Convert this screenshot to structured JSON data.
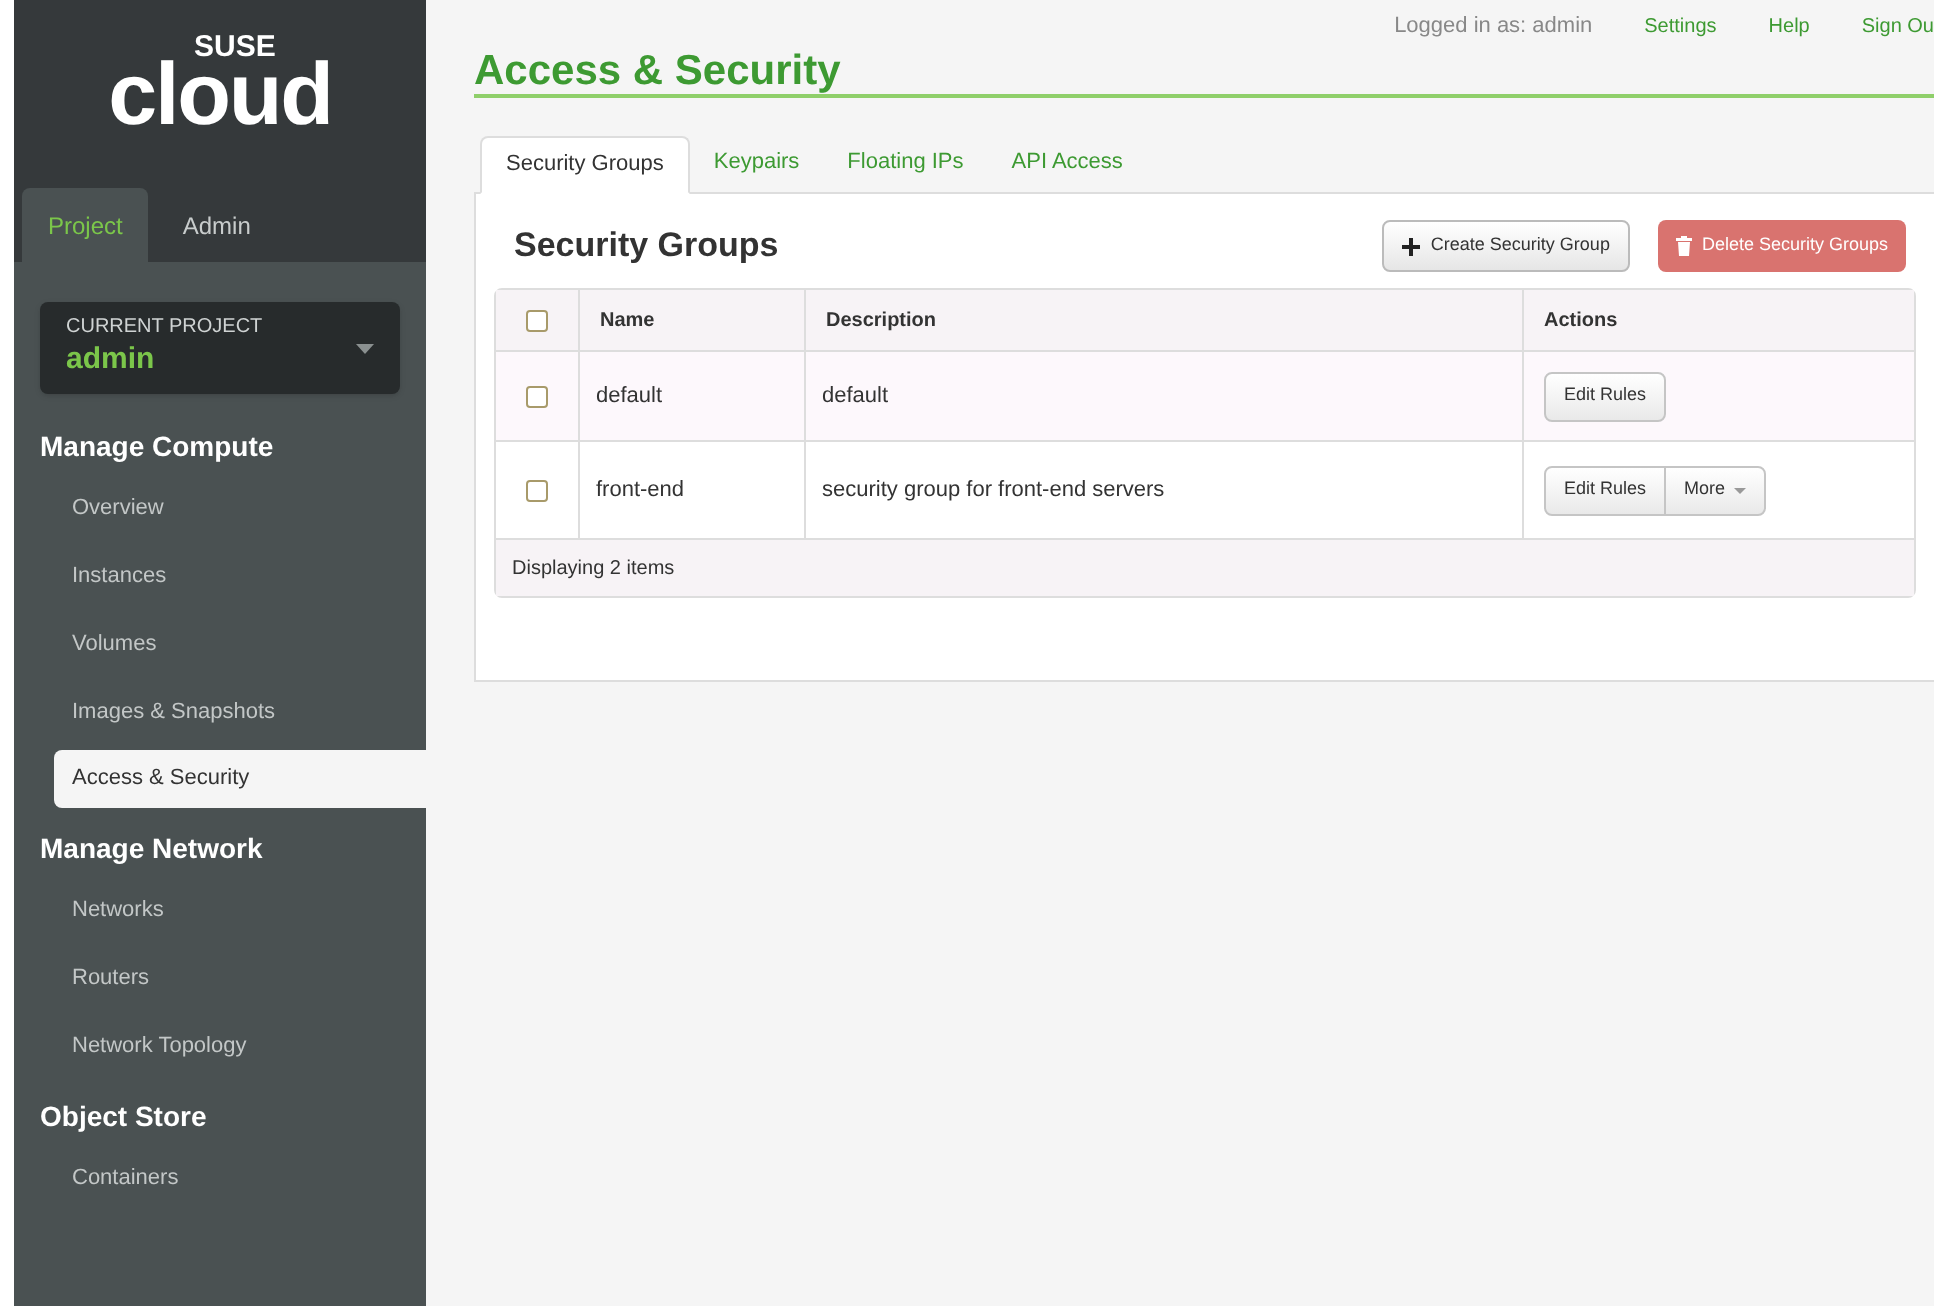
{
  "logo": {
    "brand": "SUSE",
    "product": "cloud"
  },
  "dashboard_tabs": [
    {
      "label": "Project",
      "selected": true
    },
    {
      "label": "Admin",
      "selected": false
    }
  ],
  "current_project": {
    "label": "CURRENT PROJECT",
    "value": "admin"
  },
  "sidebar": [
    {
      "heading": "Manage Compute",
      "items": [
        {
          "label": "Overview",
          "selected": false
        },
        {
          "label": "Instances",
          "selected": false
        },
        {
          "label": "Volumes",
          "selected": false
        },
        {
          "label": "Images & Snapshots",
          "selected": false
        },
        {
          "label": "Access & Security",
          "selected": true
        }
      ]
    },
    {
      "heading": "Manage Network",
      "items": [
        {
          "label": "Networks",
          "selected": false
        },
        {
          "label": "Routers",
          "selected": false
        },
        {
          "label": "Network Topology",
          "selected": false
        }
      ]
    },
    {
      "heading": "Object Store",
      "items": [
        {
          "label": "Containers",
          "selected": false
        }
      ]
    }
  ],
  "page_title": "Access & Security",
  "user_bar": {
    "logged_in": "Logged in as: admin",
    "links": [
      "Settings",
      "Help",
      "Sign Ou"
    ]
  },
  "tabs": [
    {
      "label": "Security Groups",
      "selected": true
    },
    {
      "label": "Keypairs",
      "selected": false
    },
    {
      "label": "Floating IPs",
      "selected": false
    },
    {
      "label": "API Access",
      "selected": false
    }
  ],
  "table_title": "Security Groups",
  "table_actions": [
    {
      "kind": "create",
      "label": "Create Security Group"
    },
    {
      "kind": "delete",
      "label": "Delete Security Groups"
    }
  ],
  "table": {
    "select_all_checked": false,
    "columns": [
      "Name",
      "Description",
      "Actions"
    ],
    "rows": [
      {
        "checked": false,
        "name": "default",
        "description": "default",
        "actions": [
          {
            "kind": "button",
            "label": "Edit Rules"
          }
        ]
      },
      {
        "checked": false,
        "name": "front-end",
        "description": "security group for front-end servers",
        "actions": [
          {
            "kind": "button",
            "label": "Edit Rules"
          },
          {
            "kind": "dropdown",
            "label": "More"
          }
        ]
      }
    ],
    "footer": "Displaying 2 items"
  }
}
